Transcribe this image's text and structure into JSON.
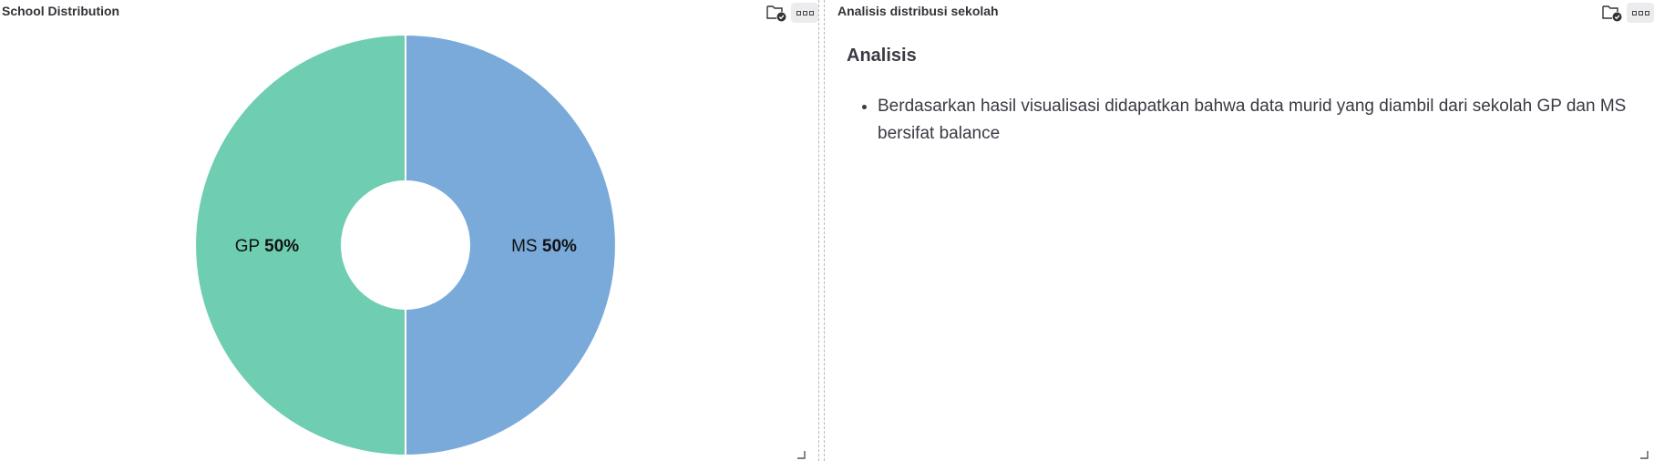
{
  "left_panel": {
    "title": "School Distribution",
    "icons": {
      "folder": "folder-check-icon",
      "more": "more-options-icon"
    }
  },
  "right_panel": {
    "title": "Analisis distribusi sekolah",
    "heading": "Analisis",
    "bullets": [
      "Berdasarkan hasil visualisasi didapatkan bahwa data murid yang diambil dari sekolah GP dan MS bersifat balance"
    ]
  },
  "chart_data": {
    "type": "pie",
    "donut": true,
    "slices": [
      {
        "label": "MS",
        "value": 50,
        "percent": "50%",
        "color": "#7aaada"
      },
      {
        "label": "GP",
        "value": 50,
        "percent": "50%",
        "color": "#6fcdb2"
      }
    ]
  }
}
